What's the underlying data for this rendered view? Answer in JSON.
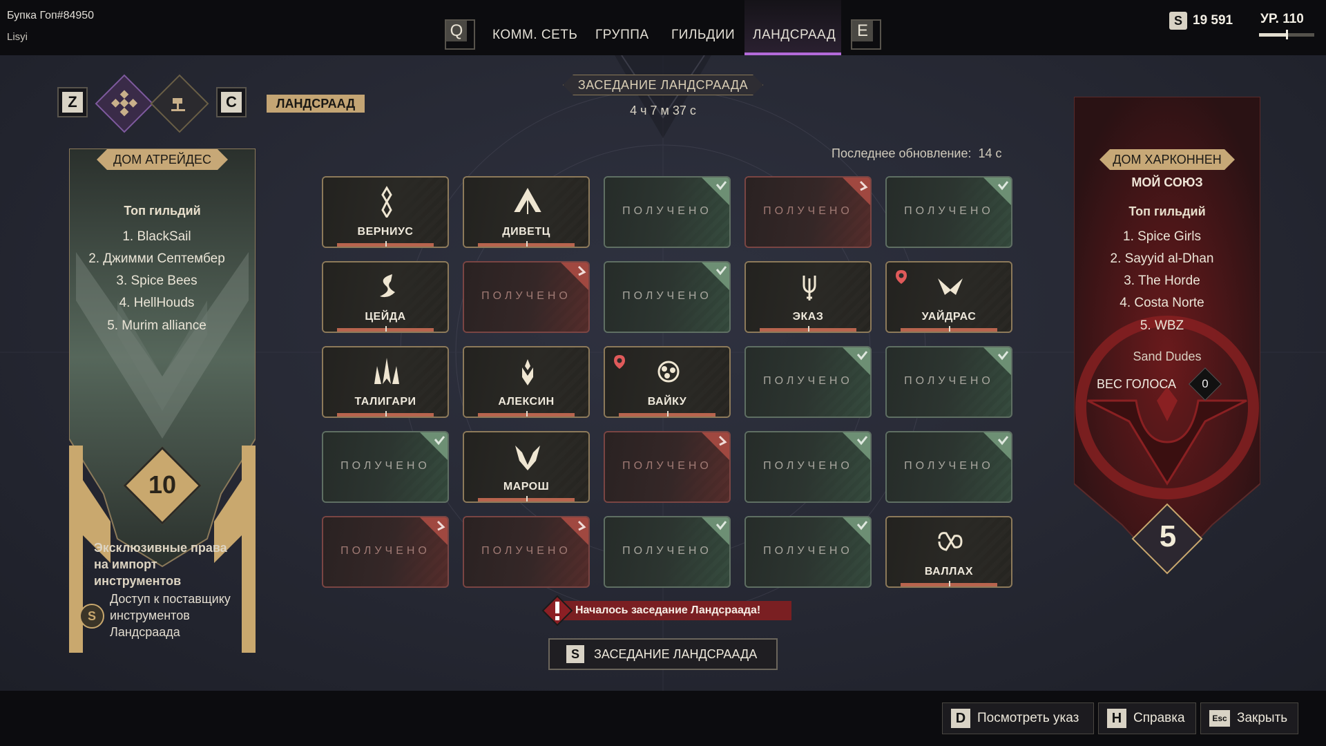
{
  "user": {
    "name": "Бупка Гоп#84950",
    "sub": "Lisyi"
  },
  "nav": {
    "key_left": "Q",
    "key_right": "E",
    "tabs": [
      "КОММ. СЕТЬ",
      "ГРУППА",
      "ГИЛЬДИИ",
      "ЛАНДСРААД"
    ],
    "active_tab": "ЛАНДСРААД"
  },
  "currency": {
    "icon": "S",
    "value": "19 591"
  },
  "level": {
    "label": "УР. 110",
    "progress": 0.5
  },
  "subnav": {
    "key_left": "Z",
    "key_right": "C",
    "label": "ЛАНДСРААД"
  },
  "session": {
    "title": "ЗАСЕДАНИЕ ЛАНДСРААДА",
    "timer": "4 ч 7 м 37 с",
    "last_update_label": "Последнее обновление:",
    "last_update_value": "14 с"
  },
  "tiles": [
    {
      "label": "ВЕРНИУС",
      "state": "active",
      "icon": "vernius-icon"
    },
    {
      "label": "ДИВЕТЦ",
      "state": "active",
      "icon": "divetz-icon"
    },
    {
      "label": "ПОЛУЧЕНО",
      "state": "done-green",
      "icon": "check-corner-icon"
    },
    {
      "label": "ПОЛУЧЕНО",
      "state": "done-red",
      "icon": "return-corner-icon"
    },
    {
      "label": "ПОЛУЧЕНО",
      "state": "done-green",
      "icon": "check-corner-icon"
    },
    {
      "label": "ЦЕЙДА",
      "state": "active",
      "icon": "tseida-icon"
    },
    {
      "label": "ПОЛУЧЕНО",
      "state": "done-red",
      "icon": "return-corner-icon"
    },
    {
      "label": "ПОЛУЧЕНО",
      "state": "done-green",
      "icon": "check-corner-icon"
    },
    {
      "label": "ЭКАЗ",
      "state": "active",
      "icon": "ekaz-icon"
    },
    {
      "label": "УАЙДРАС",
      "state": "active",
      "icon": "waydras-icon",
      "warning": true
    },
    {
      "label": "ТАЛИГАРИ",
      "state": "active",
      "icon": "taligari-icon"
    },
    {
      "label": "АЛЕКСИН",
      "state": "active",
      "icon": "alexin-icon"
    },
    {
      "label": "ВАЙКУ",
      "state": "active",
      "icon": "vaiku-icon",
      "warning": true
    },
    {
      "label": "ПОЛУЧЕНО",
      "state": "done-green",
      "icon": "check-corner-icon"
    },
    {
      "label": "ПОЛУЧЕНО",
      "state": "done-green",
      "icon": "check-corner-icon"
    },
    {
      "label": "ПОЛУЧЕНО",
      "state": "done-green",
      "icon": "check-corner-icon"
    },
    {
      "label": "МАРОШ",
      "state": "active",
      "icon": "marosh-icon"
    },
    {
      "label": "ПОЛУЧЕНО",
      "state": "done-red",
      "icon": "return-corner-icon"
    },
    {
      "label": "ПОЛУЧЕНО",
      "state": "done-green",
      "icon": "check-corner-icon"
    },
    {
      "label": "ПОЛУЧЕНО",
      "state": "done-green",
      "icon": "check-corner-icon"
    },
    {
      "label": "ПОЛУЧЕНО",
      "state": "done-red",
      "icon": "return-corner-icon"
    },
    {
      "label": "ПОЛУЧЕНО",
      "state": "done-red",
      "icon": "return-corner-icon"
    },
    {
      "label": "ПОЛУЧЕНО",
      "state": "done-green",
      "icon": "check-corner-icon"
    },
    {
      "label": "ПОЛУЧЕНО",
      "state": "done-green",
      "icon": "check-corner-icon"
    },
    {
      "label": "ВАЛЛАХ",
      "state": "active",
      "icon": "wallach-icon"
    }
  ],
  "alert": "Началось заседание Ландсраада!",
  "session_button": {
    "key": "S",
    "label": "ЗАСЕДАНИЕ ЛАНДСРААДА"
  },
  "left_house": {
    "title": "ДОМ АТРЕЙДЕС",
    "guild_head": "Топ гильдий",
    "guilds": [
      "1. BlackSail",
      "2. Джимми Септембер",
      "3. Spice Bees",
      "4. HellHouds",
      "5. Murim alliance"
    ],
    "score": "10",
    "perk_title": "Эксклюзивные права на импорт инструментов",
    "perk_title_lines": [
      "Эксклюзивные права",
      "на импорт",
      "инструментов"
    ],
    "perk_desc_lines": [
      "Доступ к поставщику",
      "инструментов",
      "Ландсраада"
    ],
    "color": "#6f7f73"
  },
  "right_house": {
    "title": "ДОМ ХАРКОННЕН",
    "subtitle": "МОЙ СОЮЗ",
    "guild_head": "Топ гильдий",
    "guilds": [
      "1. Spice Girls",
      "2. Sayyid al-Dhan",
      "3. The Horde",
      "4. Costa Norte",
      "5. WBZ"
    ],
    "my_guild": "Sand Dudes",
    "vote_label": "ВЕС ГОЛОСА",
    "vote_value": "0",
    "score": "5",
    "color": "#7a1c1e"
  },
  "bottom_buttons": [
    {
      "key": "D",
      "label": "Посмотреть указ"
    },
    {
      "key": "H",
      "label": "Справка"
    },
    {
      "key": "Esc",
      "label": "Закрыть"
    }
  ],
  "colors": {
    "accent": "#b36ad9",
    "gold": "#c7a877",
    "green": "#5f6f63",
    "red": "#7a4543"
  }
}
